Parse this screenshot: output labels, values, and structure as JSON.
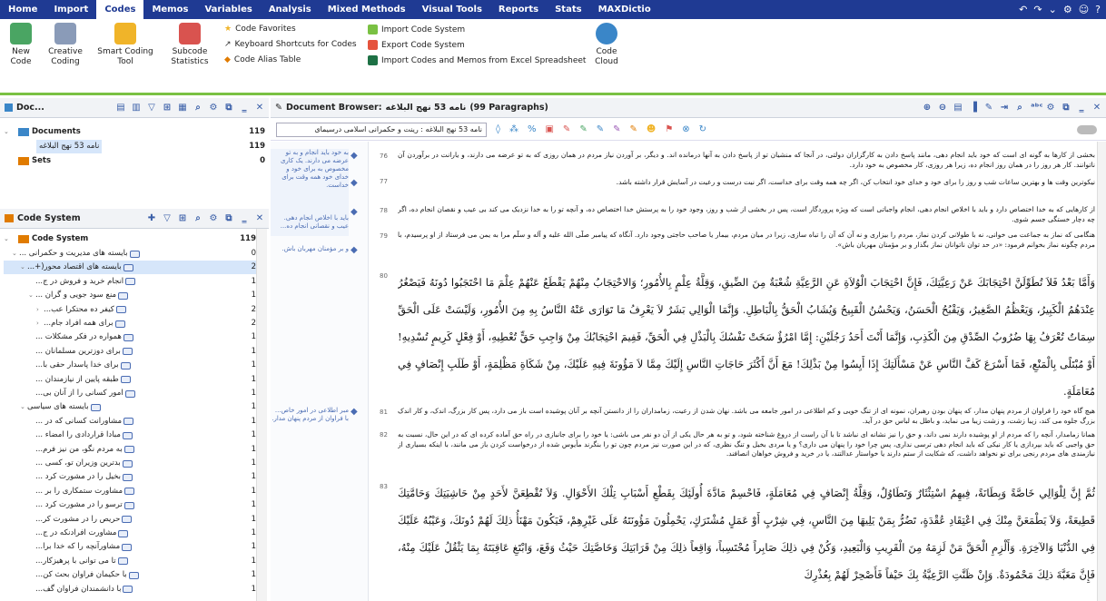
{
  "menu": {
    "items": [
      "Home",
      "Import",
      "Codes",
      "Memos",
      "Variables",
      "Analysis",
      "Mixed Methods",
      "Visual Tools",
      "Reports",
      "Stats",
      "MAXDictio"
    ],
    "active_index": 2,
    "right_icons": [
      "undo-icon",
      "redo-icon",
      "chevron-down-icon",
      "gear-icon",
      "smiley-icon",
      "help-icon"
    ]
  },
  "ribbon": {
    "new_code": "New\nCode",
    "creative_coding": "Creative\nCoding",
    "smart_coding": "Smart Coding\nTool",
    "subcode_stats": "Subcode\nStatistics",
    "code_favorites": "Code Favorites",
    "keyboard_shortcuts": "Keyboard Shortcuts for Codes",
    "code_alias": "Code Alias Table",
    "import_code_system": "Import Code System",
    "export_code_system": "Export Code System",
    "import_excel": "Import Codes and Memos from Excel Spreadsheet",
    "code_cloud": "Code\nCloud"
  },
  "document_system": {
    "title": "Doc...",
    "rows": [
      {
        "label": "Documents",
        "count": "119"
      },
      {
        "label": "نامه 53 نهج البلاغه",
        "count": "119"
      },
      {
        "label": "Sets",
        "count": "0"
      }
    ]
  },
  "code_system": {
    "title": "Code System",
    "root": {
      "label": "Code System",
      "count": "119"
    },
    "rows": [
      {
        "label": "بایسته های مدیریت و حکمرانی ...",
        "count": "0",
        "level": 1
      },
      {
        "label": "بایسته های اقتصاد محور(+...",
        "count": "2",
        "level": 2
      },
      {
        "label": "انجام خرید و فروش در ج...",
        "count": "1",
        "level": 3
      },
      {
        "label": "منع سود جویی و گران ...",
        "count": "1",
        "level": 3
      },
      {
        "label": "کیفر ده محتکرا عب...",
        "count": "2",
        "level": 4
      },
      {
        "label": "برای همه افراد جام...",
        "count": "2",
        "level": 4
      },
      {
        "label": "همواره در فکر مشکلات ...",
        "count": "1",
        "level": 3
      },
      {
        "label": "برای دوزترین مسلمانان ...",
        "count": "1",
        "level": 3
      },
      {
        "label": "برای خدا پاسدار حقی با...",
        "count": "1",
        "level": 3
      },
      {
        "label": "طبقه پایین از نیازمندان ...",
        "count": "1",
        "level": 3
      },
      {
        "label": "امور کسانی را از آنان بی...",
        "count": "1",
        "level": 3
      },
      {
        "label": "بایسته های سیاسی",
        "count": "1",
        "level": 2
      },
      {
        "label": "مشاورانت کسانی که در ...",
        "count": "1",
        "level": 3
      },
      {
        "label": "مبادا قراردادی را امضاء ...",
        "count": "1",
        "level": 3
      },
      {
        "label": "به مردم نگو، من نیز فرم...",
        "count": "1",
        "level": 3
      },
      {
        "label": "بدترین وزیران تو، کسی ...",
        "count": "1",
        "level": 3
      },
      {
        "label": "بخیل را در مشورت کرد ...",
        "count": "1",
        "level": 3
      },
      {
        "label": "مشاورت ستمکاری را بر ...",
        "count": "1",
        "level": 3
      },
      {
        "label": "ترسو را در مشورت کرد ...",
        "count": "1",
        "level": 3
      },
      {
        "label": "حریص را در مشورت کر...",
        "count": "1",
        "level": 3
      },
      {
        "label": "مشاورت افرادنکه در ج...",
        "count": "1",
        "level": 3
      },
      {
        "label": "مشاورآنچه را که خدا برا...",
        "count": "1",
        "level": 3
      },
      {
        "label": "تا می توانی با پرهیزکار...",
        "count": "1",
        "level": 3
      },
      {
        "label": "با حکیمان فراوان بحث کن...",
        "count": "1",
        "level": 3
      },
      {
        "label": "با دانشمندان فراوان گف...",
        "count": "1",
        "level": 3
      }
    ]
  },
  "document_browser": {
    "label": "Document Browser:",
    "doc_name": "نامه 53 نهج البلاغه",
    "paragraphs": "(99 Paragraphs)",
    "dropdown": "نامه 53 نهج البلاغه : رینت و حکمرانی اسلامی درسیمای",
    "line_numbers": [
      "76",
      "77",
      "78",
      "79",
      "80",
      "81",
      "82",
      "83"
    ],
    "memos": [
      "به خود باید انجام و به تو عرضه می دارند. یک کاری مخصوص به برای خود و خدای خود همه وقت برای خداست.",
      "باید با اخلاص انجام دهی. عیب و نقصانی انجام ده...",
      "و بر مؤمنان مهربان باش.",
      "مبر اطلاعی در امور خاص... با فراوان از مردم پنهان مدار."
    ],
    "p76": "بخشی از کارها به گونه ای است که خود باید انجام دهی، مانند پاسخ دادن به کارگزاران دولتی، در آنجا که منشیان تو از پاسخ دادن به آنها درمانده اند. و دیگر، بر آوردن نیاز مردم در همان روزی که به تو عرضه می دارند، و یارانت در برآوردن آن ناتوانند. کار هر روز را در همان روز انجام ده، زیرا هر روزی، کار مخصوص به خود دارد.",
    "p77": "نیکوترین وقت ها و بهترین ساعات شب و روز را برای خود و خدای خود انتخاب کن، اگر چه همه وقت برای خداست، اگر نیت درست و رعیت در آسایش قرار داشته باشد.",
    "p78": "از کارهایی که به خدا اختصاص دارد و باید با اخلاص انجام دهی، انجام واجباتی است که ویژه پروردگار است، پس در بخشی از شب و روز، وجود خود را به پرستش خدا اختصاص ده، و آنچه تو را به خدا نزدیک می کند بی عیب و نقصان انجام ده، اگر چه دچار خستگی جسم شوی.",
    "p79": "هنگامی که نماز به جماعت می خوانی، نه با طولانی کردن نماز، مردم را بیزاری و نه آن که آن را تباه سازی، زیرا در میان مردم، بیمار یا صاحب حاجتی وجود دارد. آنگاه که پیامبر صلّی الله علیه و آله و سلّم مرا به یمن می فرستاد از او پرسیدم، با مردم چگونه نماز بخوانم فرمود: «در حد توان ناتوانان نماز بگذار و بر مؤمنان مهربان باش».",
    "p80": "وَأَمَّا بَعْدُ فَلاَ تُطَوِّلَنَّ احْتِجَابَكَ عَنْ رَعِيَّتِكَ، فَإِنَّ احْتِجَابَ الْوُلاَةِ عَنِ الرَّعِيَّةِ شُعْبَةٌ مِنَ الضِّيقِ، وَقِلَّةُ عِلْمٍ بِالأُمُورِ؛ وَالاحْتِجَابُ مِنْهُمْ يَقْطَعُ عَنْهُمْ عِلْمَ مَا احْتَجَبُوا دُونَهُ فَيَصْغُرُ عِنْدَهُمُ الْكَبِيرُ، وَيَعْظُمُ الصَّغِيرُ، وَيَقْبُحُ الْحَسَنُ، وَيَحْسُنُ الْقَبِيحُ وَيُشَابُ الْحَقُّ بِالْبَاطِلِ. وَإِنَّمَا الْوَالِي بَشَرٌ لاَ يَعْرِفُ مَا تَوَارَى عَنْهُ النَّاسُ بِهِ مِنَ الأُمُورِ، وَلَيْسَتْ عَلَى الْحَقِّ سِمَاتٌ تُعْرَفُ بِهَا ضُرُوبُ الصِّدْقِ مِنَ الْكَذِبِ، وَإِنَّمَا أَنْتَ أَحَدُ رَجُلَيْنِ: إِمَّا امْرُؤٌ سَخَتْ نَفْسُكَ بِالْبَذْلِ فِي الْحَقِّ، فَفِيمَ احْتِجَابُكَ مِنْ وَاجِبِ حَقٍّ تُعْطِيهِ، أَوْ فِعْلٍ كَرِيمٍ تُسْدِيهِ! أَوْ مُبْتَلًى بِالْمَنْعِ، فَمَا أَسْرَعَ كَفَّ النَّاسِ عَنْ مَسْأَلَتِكَ إِذَا أَيِسُوا مِنْ بَذْلِكَ! مَعَ أَنَّ أَكْثَرَ حَاجَاتِ النَّاسِ إِلَيْكَ مِمَّا لاَ مَؤُونَةَ فِيهِ عَلَيْكَ، مِنْ شَكَاةِ مَظْلِمَةٍ، أَوْ طَلَبِ إِنْصَافٍ فِي مُعَامَلَةٍ.",
    "p81": "هیچ گاه خود را فراوان از مردم پنهان مدار، که پنهان بودن رهبران، نمونه ای از تنگ خویی و کم اطلاعی در امور جامعه می باشد. نهان شدن از رعیت، زمامداران را از دانستن آنچه بر آنان پوشیده است باز می دارد، پس کار بزرگ، اندک، و کار اندک بزرگ جلوه می کند، زیبا زشت، و زشت زیبا می نماید، و باطل به لباس حق در آید.",
    "p82": "همانا زمامدار، آنچه را که مردم از او پوشیده دارند نمی داند، و حق را نیز نشانه ای نباشد تا با آن راست از دروغ شناخته شود، و تو به هر حال یکی از آن دو نفر می باشی: یا خود را برای جانبازی در راه حق آماده کرده ای که در این حال، نسبت به حق واجبی که باید بپردازی یا کار نیکی که باید انجام دهی ترسی نداری، پس چرا خود را پنهان می داری؟ و یا مردی بخیل و تنگ نظری، که در این صورت نیز مردم چون تو را بنگرند مأیوس شده از درخواست کردن باز می مانند، با اینکه بسیاری از نیازمندی های مردم رنجی برای تو نخواهد داشت، که شکایت از ستم دارند یا خواستار عدالتند، یا در خرید و فروش خواهان انصافند.",
    "p83": "ثُمَّ إِنَّ لِلْوَالِي خَاصَّةً وَبِطَانَةً، فِيهِمُ اسْتِئْثَارٌ وَتَطَاوُلٌ، وَقِلَّةُ إِنْصَافٍ فِي مُعَامَلَةٍ، فَاحْسِمْ مَادَّةَ أُولَئِكَ بِقَطْعِ أَسْبَابِ تِلْكَ الأَحْوَالِ. وَلاَ تُقْطِعَنَّ لأَحَدٍ مِنْ حَاشِيَتِكَ وَحَامَّتِكَ قَطِيعَةً، وَلاَ يَطْمَعَنَّ مِنْكَ فِي اعْتِقَادِ عُقْدَةٍ، تَضُرُّ بِمَنْ يَلِيهَا مِنَ النَّاسِ، فِي شِرْبٍ أَوْ عَمَلٍ مُشْتَرَكٍ، يَحْمِلُونَ مَؤُونَتَهُ عَلَى غَيْرِهِمْ، فَيَكُونَ مَهْنَأُ ذلِكَ لَهُمْ دُونَكَ، وَعَيْبُهُ عَلَيْكَ فِي الدُّنْيَا وَالآخِرَةِ. وَأَلْزِمِ الْحَقَّ مَنْ لَزِمَهُ مِنَ الْقَرِيبِ وَالْبَعِيدِ، وَكُنْ فِي ذلِكَ صَابِراً مُحْتَسِباً، وَاقِعاً ذلِكَ مِنْ قَرَابَتِكَ وَخَاصَّتِكَ حَيْثُ وَقَعَ، وَابْتَغِ عَاقِبَتَهُ بِمَا يَثْقُلُ عَلَيْكَ مِنْهُ، فَإِنَّ مَغَبَّةَ ذلِكَ مَحْمُودَةٌ. وَإِنْ ظَنَّتِ الرَّعِيَّةُ بِكَ حَيْفاً فَأَصْحِرْ لَهُمْ بِعُذْرِكَ"
  },
  "colors": {
    "menubar": "#1f3a93",
    "accent_green": "#7ac143",
    "code_blue": "#4a6cb3"
  }
}
